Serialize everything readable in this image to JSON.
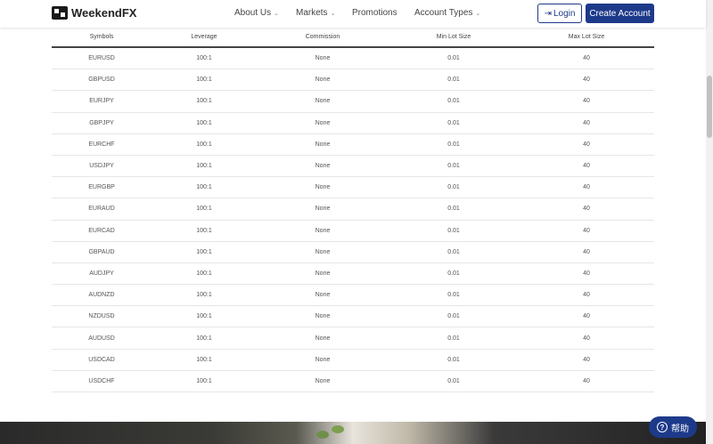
{
  "header": {
    "brand": "WeekendFX",
    "nav": [
      {
        "label": "About Us",
        "dropdown": true
      },
      {
        "label": "Markets",
        "dropdown": true
      },
      {
        "label": "Promotions",
        "dropdown": false
      },
      {
        "label": "Account Types",
        "dropdown": true
      }
    ],
    "login_label": "Login",
    "create_label": "Create Account"
  },
  "table": {
    "columns": [
      "Symbols",
      "Leverage",
      "Commission",
      "Min Lot Size",
      "Max Lot Size"
    ],
    "rows": [
      [
        "EURUSD",
        "100:1",
        "None",
        "0.01",
        "40"
      ],
      [
        "GBPUSD",
        "100:1",
        "None",
        "0.01",
        "40"
      ],
      [
        "EURJPY",
        "100:1",
        "None",
        "0.01",
        "40"
      ],
      [
        "GBPJPY",
        "100:1",
        "None",
        "0.01",
        "40"
      ],
      [
        "EURCHF",
        "100:1",
        "None",
        "0.01",
        "40"
      ],
      [
        "USDJPY",
        "100:1",
        "None",
        "0.01",
        "40"
      ],
      [
        "EURGBP",
        "100:1",
        "None",
        "0.01",
        "40"
      ],
      [
        "EURAUD",
        "100:1",
        "None",
        "0.01",
        "40"
      ],
      [
        "EURCAD",
        "100:1",
        "None",
        "0.01",
        "40"
      ],
      [
        "GBPAUD",
        "100:1",
        "None",
        "0.01",
        "40"
      ],
      [
        "AUDJPY",
        "100:1",
        "None",
        "0.01",
        "40"
      ],
      [
        "AUDNZD",
        "100:1",
        "None",
        "0.01",
        "40"
      ],
      [
        "NZDUSD",
        "100:1",
        "None",
        "0.01",
        "40"
      ],
      [
        "AUDUSD",
        "100:1",
        "None",
        "0.01",
        "40"
      ],
      [
        "USDCAD",
        "100:1",
        "None",
        "0.01",
        "40"
      ],
      [
        "USDCHF",
        "100:1",
        "None",
        "0.01",
        "40"
      ]
    ]
  },
  "help": {
    "label": "帮助"
  },
  "colors": {
    "primary": "#1d3a8a"
  }
}
